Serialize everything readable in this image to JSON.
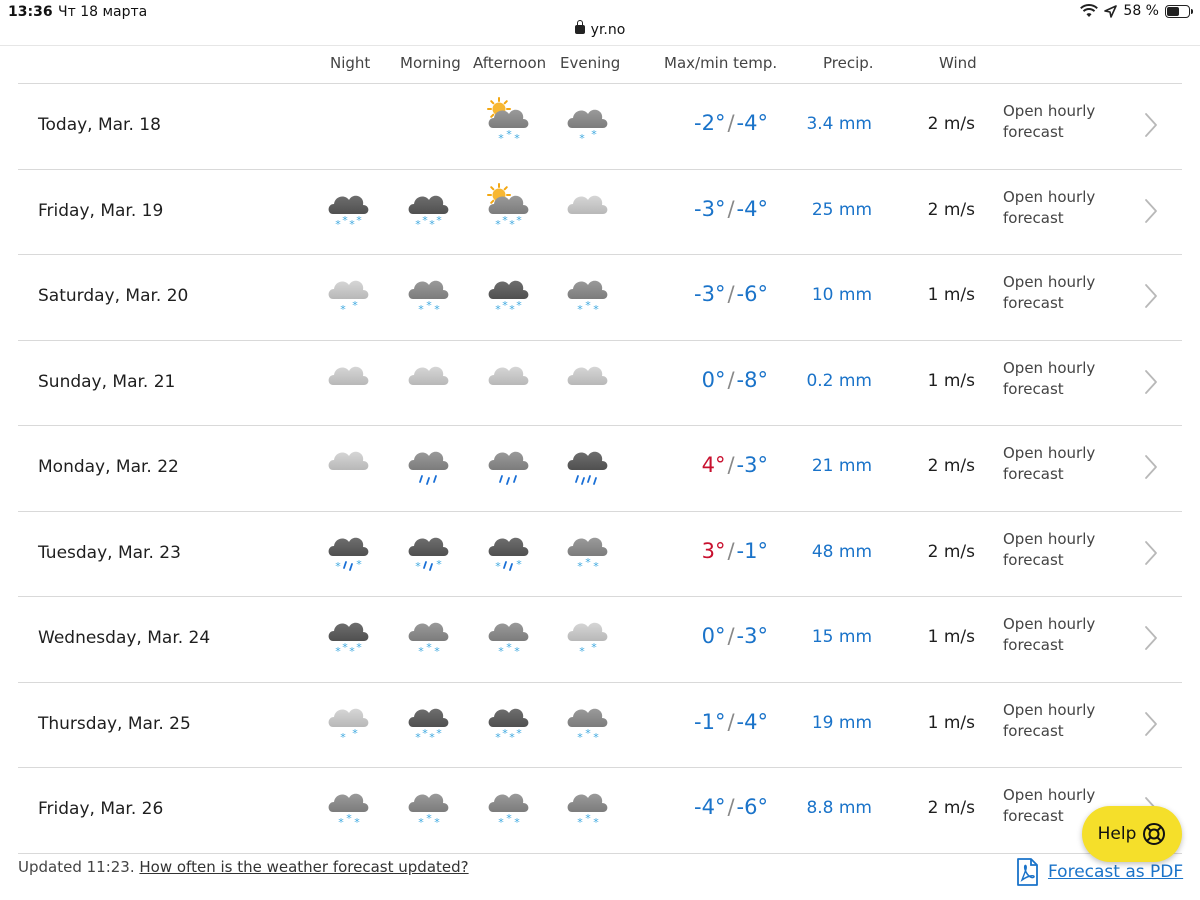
{
  "status_bar": {
    "time": "13:36",
    "date": "Чт 18 марта",
    "battery": "58 %",
    "battery_level": 0.58
  },
  "url_bar": {
    "domain": "yr.no"
  },
  "table": {
    "headers": {
      "night": "Night",
      "morning": "Morning",
      "afternoon": "Afternoon",
      "evening": "Evening",
      "temp": "Max/min temp.",
      "precip": "Precip.",
      "wind": "Wind"
    },
    "rows": [
      {
        "day": "Today, Mar. 18",
        "icons": [
          "",
          "",
          "partly-sunny-snow-icon",
          "cloud-light-snow-icon"
        ],
        "max": "-2°",
        "min": "-4°",
        "precip": "3.4 mm",
        "wind": "2 m/s",
        "hourly": "Open hourly forecast"
      },
      {
        "day": "Friday, Mar. 19",
        "icons": [
          "dark-cloud-heavy-snow-icon",
          "dark-cloud-heavy-snow-icon",
          "partly-sunny-heavy-snow-icon",
          "light-cloud-icon"
        ],
        "max": "-3°",
        "min": "-4°",
        "precip": "25 mm",
        "wind": "2 m/s",
        "hourly": "Open hourly forecast"
      },
      {
        "day": "Saturday, Mar. 20",
        "icons": [
          "light-cloud-light-snow-icon",
          "cloud-snow-icon",
          "dark-cloud-heavy-snow-icon",
          "cloud-snow-icon"
        ],
        "max": "-3°",
        "min": "-6°",
        "precip": "10 mm",
        "wind": "1 m/s",
        "hourly": "Open hourly forecast"
      },
      {
        "day": "Sunday, Mar. 21",
        "icons": [
          "light-cloud-icon",
          "light-cloud-icon",
          "light-cloud-icon",
          "light-cloud-icon"
        ],
        "max": "0°",
        "min": "-8°",
        "precip": "0.2 mm",
        "wind": "1 m/s",
        "hourly": "Open hourly forecast"
      },
      {
        "day": "Monday, Mar. 22",
        "icons": [
          "light-cloud-icon",
          "cloud-rain-icon",
          "cloud-rain-icon",
          "dark-cloud-heavy-rain-icon"
        ],
        "max": "4°",
        "min": "-3°",
        "precip": "21 mm",
        "wind": "2 m/s",
        "hourly": "Open hourly forecast"
      },
      {
        "day": "Tuesday, Mar. 23",
        "icons": [
          "dark-cloud-sleet-icon",
          "dark-cloud-sleet-icon",
          "dark-cloud-sleet-icon",
          "cloud-snow-icon"
        ],
        "max": "3°",
        "min": "-1°",
        "precip": "48 mm",
        "wind": "2 m/s",
        "hourly": "Open hourly forecast"
      },
      {
        "day": "Wednesday, Mar. 24",
        "icons": [
          "dark-cloud-heavy-snow-icon",
          "cloud-snow-icon",
          "cloud-snow-icon",
          "light-cloud-light-snow-icon"
        ],
        "max": "0°",
        "min": "-3°",
        "precip": "15 mm",
        "wind": "1 m/s",
        "hourly": "Open hourly forecast"
      },
      {
        "day": "Thursday, Mar. 25",
        "icons": [
          "light-cloud-light-snow-icon",
          "dark-cloud-heavy-snow-icon",
          "dark-cloud-heavy-snow-icon",
          "cloud-snow-icon"
        ],
        "max": "-1°",
        "min": "-4°",
        "precip": "19 mm",
        "wind": "1 m/s",
        "hourly": "Open hourly forecast"
      },
      {
        "day": "Friday, Mar. 26",
        "icons": [
          "cloud-snow-icon",
          "cloud-snow-icon",
          "cloud-snow-icon",
          "cloud-snow-icon"
        ],
        "max": "-4°",
        "min": "-6°",
        "precip": "8.8 mm",
        "wind": "2 m/s",
        "hourly": "Open hourly forecast"
      }
    ]
  },
  "footer": {
    "updated": "Updated 11:23.",
    "link": "How often is the weather forecast updated?",
    "pdf": "Forecast as PDF"
  },
  "help_button": {
    "label": "Help"
  },
  "colors": {
    "cold": "#1a73c9",
    "warm": "#c8102e",
    "precip": "#1a73c9",
    "help_bg": "#f5df2a",
    "snow": "#3fa9e0"
  }
}
